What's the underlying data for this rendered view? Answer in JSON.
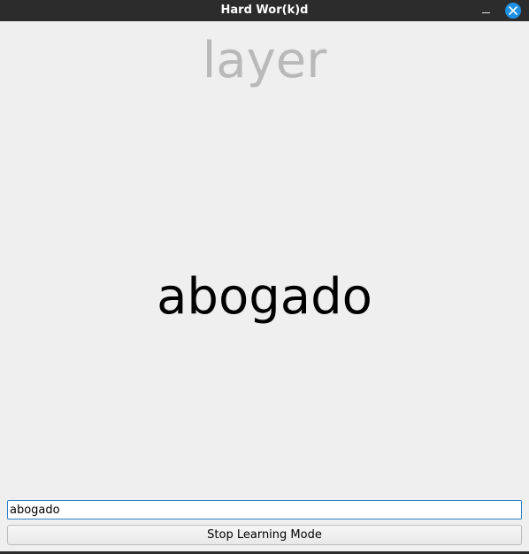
{
  "window": {
    "title": "Hard Wor(k)d"
  },
  "controls": {
    "minimize_icon": "minimize-icon",
    "close_icon": "close-icon",
    "close_color": "#1e90e4"
  },
  "flashcard": {
    "hint_word": "layer",
    "target_word": "abogado"
  },
  "answer": {
    "value": "abogado"
  },
  "actions": {
    "stop_label": "Stop Learning Mode"
  }
}
